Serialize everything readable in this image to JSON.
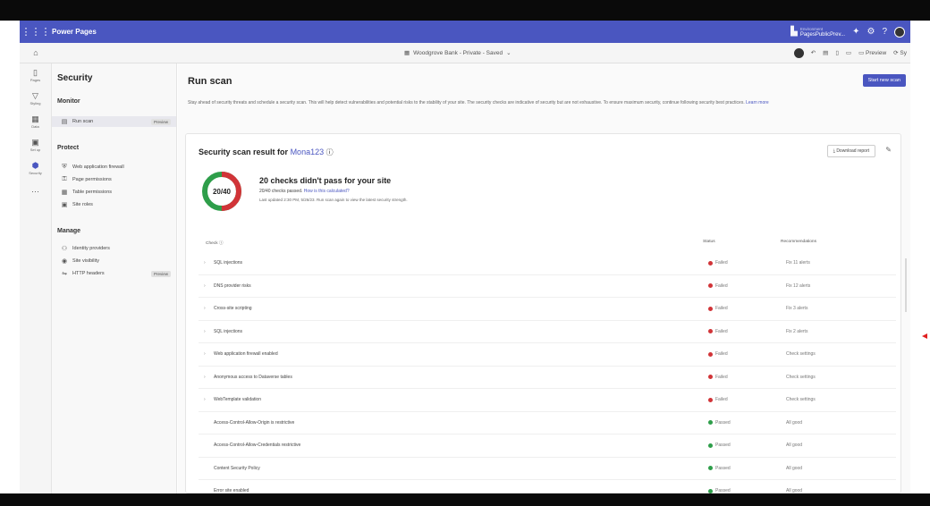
{
  "topbar": {
    "app_name": "Power Pages",
    "env_label": "Environment",
    "env_name": "PagesPublicPrev..."
  },
  "cmdbar": {
    "site_label": "Woodgrove Bank - Private - Saved",
    "preview_label": "Preview",
    "sync_label": "Sy"
  },
  "rail": [
    {
      "label": "Pages",
      "icon": "page-icon"
    },
    {
      "label": "Styling",
      "icon": "brush-icon"
    },
    {
      "label": "Data",
      "icon": "table-icon"
    },
    {
      "label": "Set up",
      "icon": "setup-icon"
    },
    {
      "label": "Security",
      "icon": "shield-icon"
    }
  ],
  "sidebar": {
    "title": "Security",
    "monitor": "Monitor",
    "run_scan": "Run scan",
    "run_scan_badge": "Preview",
    "protect": "Protect",
    "protect_items": [
      "Web application firewall",
      "Page permissions",
      "Table permissions",
      "Site roles"
    ],
    "manage": "Manage",
    "manage_items": [
      "Identity providers",
      "Site visibility",
      "HTTP headers"
    ],
    "http_badge": "Preview"
  },
  "main": {
    "title": "Run scan",
    "start_button": "Start new scan",
    "description": "Stay ahead of security threats and schedule a security scan. This will help detect vulnerabilities and potential risks to the stability of your site. The security checks are indicative of security but are not exhaustive. To ensure maximum security, continue following security best practices.",
    "learn_more": "Learn more"
  },
  "card": {
    "title_prefix": "Security scan result for",
    "site": "Mona123",
    "download": "Download report",
    "score": "20/40",
    "passed_fraction": 0.5,
    "headline": "20 checks didn't pass for your site",
    "sub1": "20/40 checks passed.",
    "sub1_link": "How is this calculated?",
    "sub2": "Last updated 2:30 PM, 5/26/23. Run scan again to view the latest security strength."
  },
  "table": {
    "headers": {
      "check": "Check ⓘ",
      "status": "Status",
      "rec": "Recommendations"
    },
    "rows": [
      {
        "check": "SQL injections",
        "status": "Failed",
        "rec": "Fix 11 alerts",
        "expand": true
      },
      {
        "check": "DNS provider risks",
        "status": "Failed",
        "rec": "Fix 12 alerts",
        "expand": true
      },
      {
        "check": "Cross-site scripting",
        "status": "Failed",
        "rec": "Fix 3 alerts",
        "expand": true
      },
      {
        "check": "SQL injections",
        "status": "Failed",
        "rec": "Fix 2 alerts",
        "expand": true
      },
      {
        "check": "Web application firewall enabled",
        "status": "Failed",
        "rec": "Check settings",
        "expand": true
      },
      {
        "check": "Anonymous access to Dataverse tables",
        "status": "Failed",
        "rec": "Check settings",
        "expand": true
      },
      {
        "check": "WebTemplate validation",
        "status": "Failed",
        "rec": "Check settings",
        "expand": true
      },
      {
        "check": "Access-Control-Allow-Origin is restrictive",
        "status": "Passed",
        "rec": "All good",
        "expand": false
      },
      {
        "check": "Access-Control-Allow-Credentials restrictive",
        "status": "Passed",
        "rec": "All good",
        "expand": false
      },
      {
        "check": "Content Security Policy",
        "status": "Passed",
        "rec": "All good",
        "expand": false
      },
      {
        "check": "Error site enabled",
        "status": "Passed",
        "rec": "All good",
        "expand": false
      }
    ]
  },
  "colors": {
    "accent": "#4a56c0",
    "failed": "#d13438",
    "passed": "#2e9e4a"
  }
}
